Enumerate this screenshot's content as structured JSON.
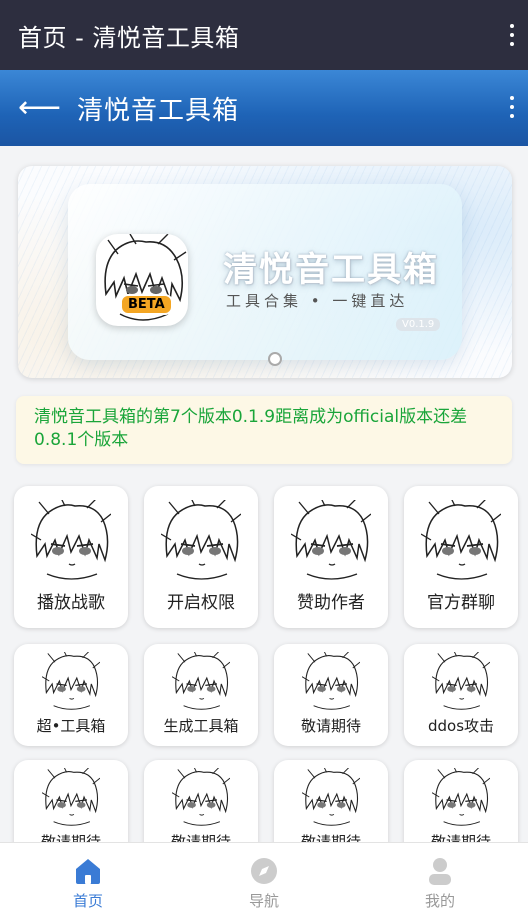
{
  "status_bar": {
    "title": "首页 - 清悦音工具箱",
    "menu_icon": "more-vert-icon"
  },
  "app_bar": {
    "back_icon": "arrow-left-icon",
    "title": "清悦音工具箱",
    "menu_icon": "more-vert-icon"
  },
  "banner": {
    "app_name": "清悦音工具箱",
    "subtitle": "工具合集 • 一键直达",
    "badge": "BETA",
    "version": "V0.1.9",
    "dot_index": 1
  },
  "notice": {
    "text": "清悦音工具箱的第7个版本0.1.9距离成为official版本还差0.8.1个版本"
  },
  "tools": [
    {
      "label": "播放战歌"
    },
    {
      "label": "开启权限"
    },
    {
      "label": "赞助作者"
    },
    {
      "label": "官方群聊"
    },
    {
      "label": "超•工具箱"
    },
    {
      "label": "生成工具箱"
    },
    {
      "label": "敬请期待"
    },
    {
      "label": "ddos攻击"
    },
    {
      "label": "敬请期待"
    },
    {
      "label": "敬请期待"
    },
    {
      "label": "敬请期待"
    },
    {
      "label": "敬请期待"
    }
  ],
  "tab_bar": {
    "items": [
      {
        "label": "首页",
        "icon": "home-icon",
        "active": true
      },
      {
        "label": "导航",
        "icon": "compass-icon",
        "active": false
      },
      {
        "label": "我的",
        "icon": "user-icon",
        "active": false
      }
    ]
  },
  "colors": {
    "status_bar": "#2d2e3f",
    "app_bar": "#1e63b6",
    "notice_text": "#1aa53a",
    "notice_bg": "#fdf8e6",
    "tab_active": "#3a7bd5",
    "tab_inactive": "#999999"
  }
}
